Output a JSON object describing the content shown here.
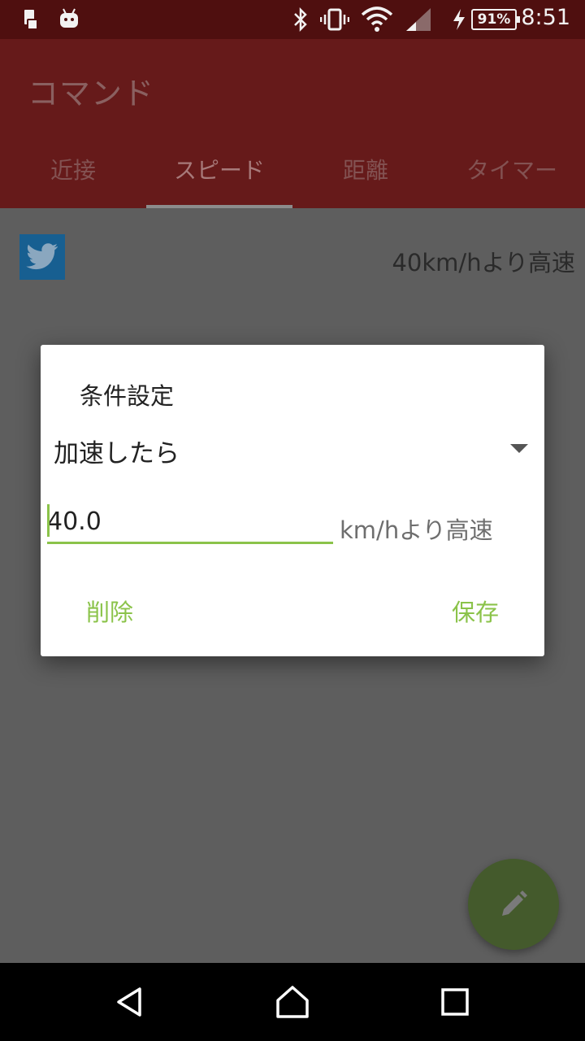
{
  "status_bar": {
    "time": "8:51",
    "battery": "91%",
    "icons": [
      "sim-icon",
      "android-icon",
      "bluetooth-icon",
      "vibrate-icon",
      "wifi-icon",
      "signal-icon",
      "charging-icon"
    ]
  },
  "app_bar": {
    "title": "コマンド"
  },
  "tabs": [
    {
      "label": "近接"
    },
    {
      "label": "スピード"
    },
    {
      "label": "距離"
    },
    {
      "label": "タイマー"
    }
  ],
  "content": {
    "item_label": "40km/hより高速",
    "item_icon": "twitter-icon"
  },
  "dialog": {
    "title": "条件設定",
    "select_value": "加速したら",
    "input_value": "40.0",
    "unit_label": "km/hより高速",
    "delete_label": "削除",
    "save_label": "保存"
  },
  "fab": {
    "icon": "pencil-icon"
  },
  "nav": {
    "icons": [
      "back-icon",
      "home-icon",
      "recents-icon"
    ]
  },
  "colors": {
    "accent": "#8bc34a",
    "app_bar_dimmed": "#661a1a",
    "status_bar": "#4f0f0f",
    "scrim_background": "#5e5e5e",
    "twitter_dimmed": "#175f91"
  }
}
